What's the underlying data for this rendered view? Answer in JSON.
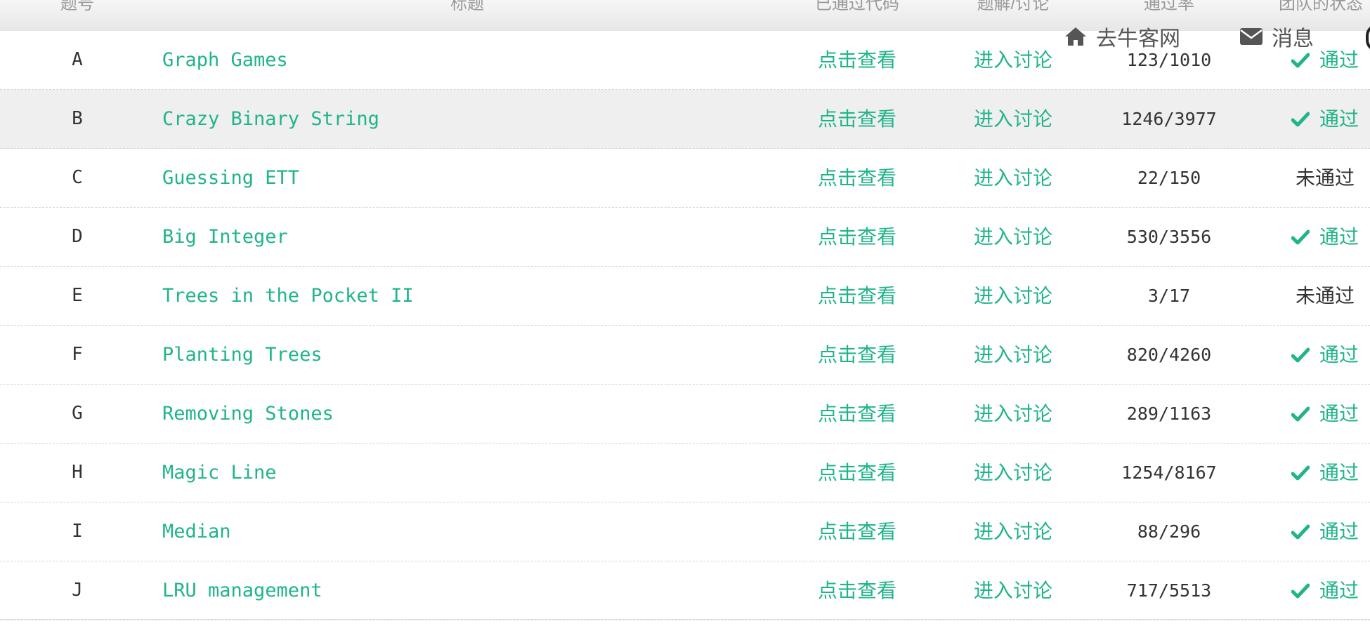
{
  "table": {
    "headers": {
      "id": "题号",
      "title": "标题",
      "code": "已通过代码",
      "discussion": "题解/讨论",
      "rate": "通过率",
      "status": "团队的状态"
    },
    "rows": [
      {
        "id": "A",
        "title": "Graph Games",
        "code": "点击查看",
        "discussion": "进入讨论",
        "rate": "123/1010",
        "status": "通过",
        "passed": true
      },
      {
        "id": "B",
        "title": "Crazy Binary String",
        "code": "点击查看",
        "discussion": "进入讨论",
        "rate": "1246/3977",
        "status": "通过",
        "passed": true
      },
      {
        "id": "C",
        "title": "Guessing ETT",
        "code": "点击查看",
        "discussion": "进入讨论",
        "rate": "22/150",
        "status": "未通过",
        "passed": false
      },
      {
        "id": "D",
        "title": "Big Integer",
        "code": "点击查看",
        "discussion": "进入讨论",
        "rate": "530/3556",
        "status": "通过",
        "passed": true
      },
      {
        "id": "E",
        "title": "Trees in the Pocket II",
        "code": "点击查看",
        "discussion": "进入讨论",
        "rate": "3/17",
        "status": "未通过",
        "passed": false
      },
      {
        "id": "F",
        "title": "Planting Trees",
        "code": "点击查看",
        "discussion": "进入讨论",
        "rate": "820/4260",
        "status": "通过",
        "passed": true
      },
      {
        "id": "G",
        "title": "Removing Stones",
        "code": "点击查看",
        "discussion": "进入讨论",
        "rate": "289/1163",
        "status": "通过",
        "passed": true
      },
      {
        "id": "H",
        "title": "Magic Line",
        "code": "点击查看",
        "discussion": "进入讨论",
        "rate": "1254/8167",
        "status": "通过",
        "passed": true
      },
      {
        "id": "I",
        "title": "Median",
        "code": "点击查看",
        "discussion": "进入讨论",
        "rate": "88/296",
        "status": "通过",
        "passed": true
      },
      {
        "id": "J",
        "title": "LRU management",
        "code": "点击查看",
        "discussion": "进入讨论",
        "rate": "717/5513",
        "status": "通过",
        "passed": true
      }
    ]
  },
  "topnav": {
    "home_label": "去牛客网",
    "home_icon": "home-icon",
    "messages_label": "消息",
    "messages_icon": "envelope-icon"
  },
  "colors": {
    "accent": "#20b48b",
    "text": "#333333",
    "header_text": "#999999",
    "hover_row": "#efefef"
  }
}
